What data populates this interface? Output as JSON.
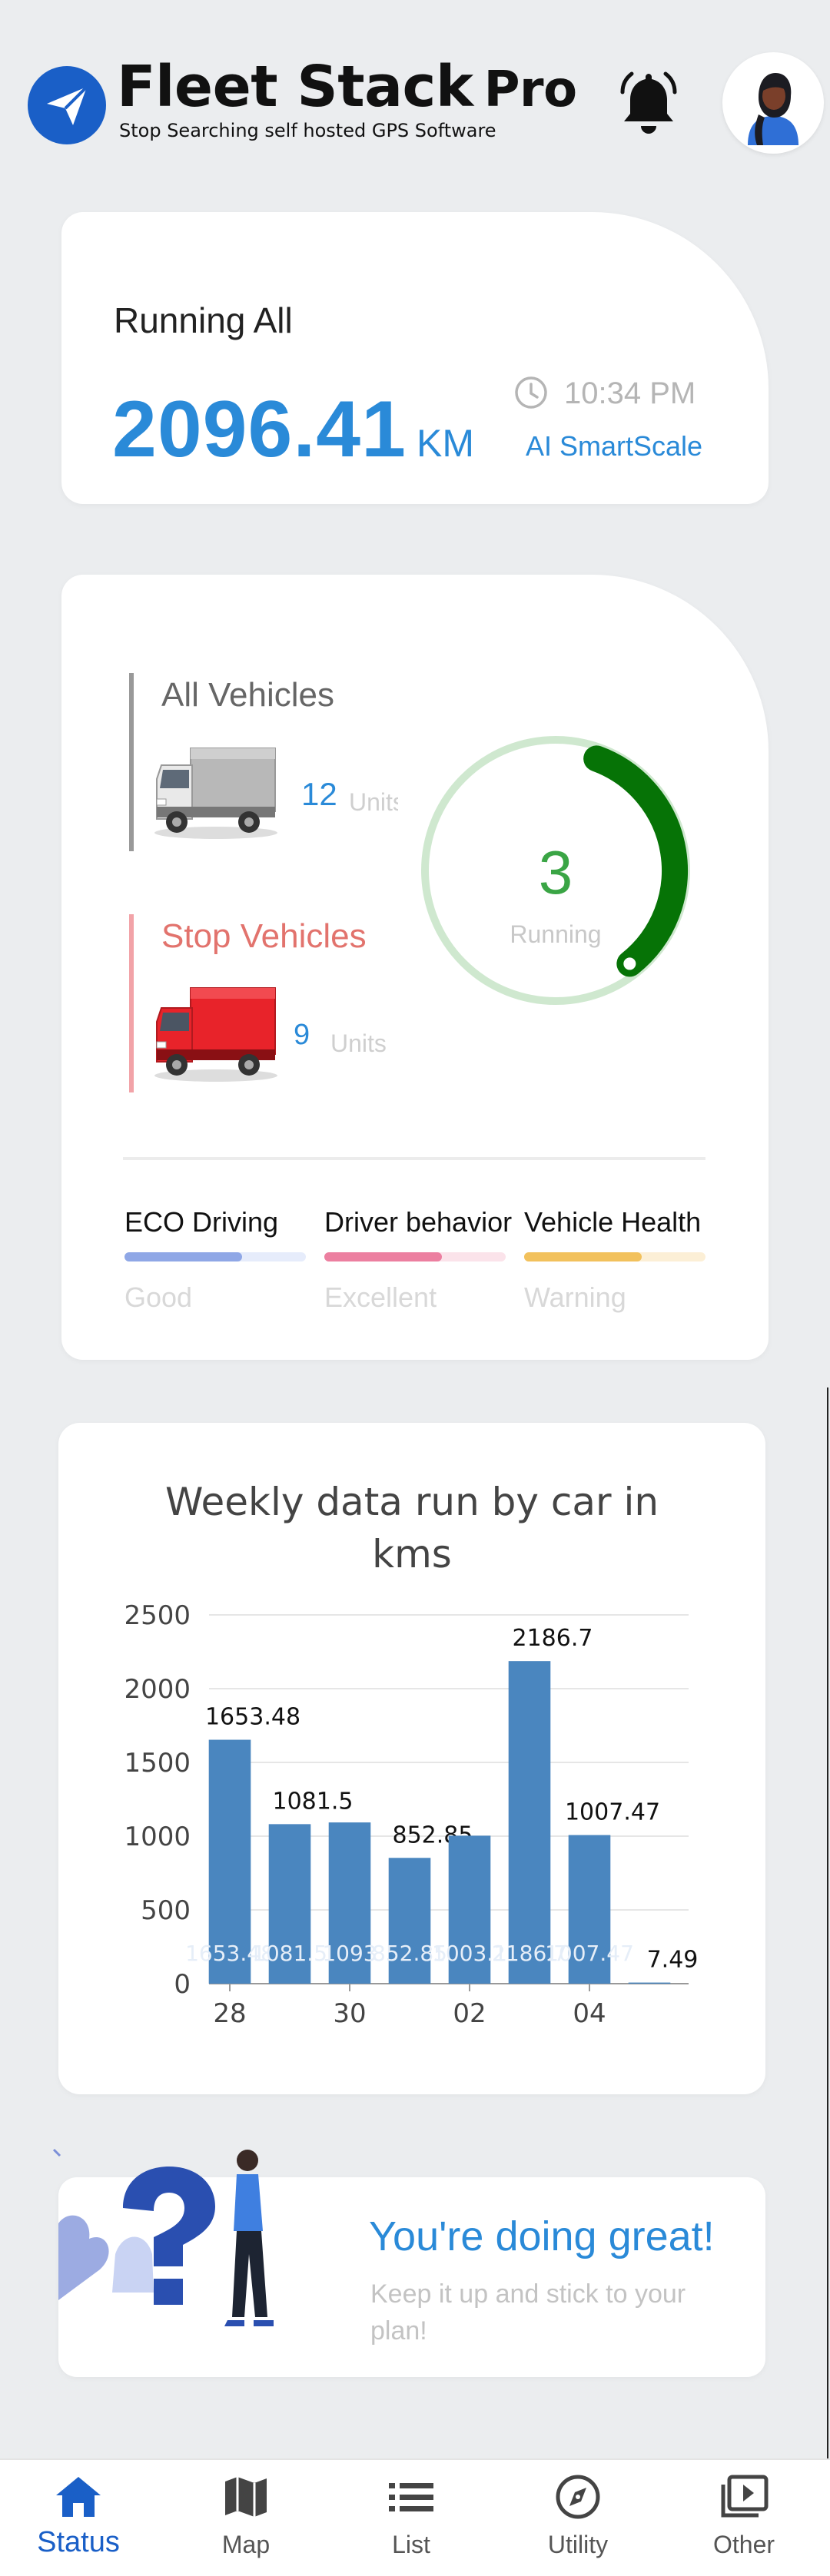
{
  "header": {
    "brand_title": "Fleet Stack",
    "brand_pro": "Pro",
    "brand_subtitle": "Stop Searching self hosted GPS Software",
    "bell_icon": "bell-icon",
    "avatar_icon": "user-avatar"
  },
  "distance_card": {
    "title": "Running All",
    "value": "2096.41",
    "unit": "KM",
    "time": "10:34 PM",
    "smartscale_label": "AI SmartScale"
  },
  "vehicles_card": {
    "all": {
      "title": "All Vehicles",
      "count": "12",
      "unit": "Units"
    },
    "stop": {
      "title": "Stop Vehicles",
      "count": "9",
      "unit": "Units"
    },
    "running": {
      "count": "3",
      "label": "Running",
      "fraction": 0.25
    },
    "metrics": [
      {
        "title": "ECO Driving",
        "value": "Good",
        "fill": 0.65,
        "color": "#8fa7e6",
        "track": "#e6ecfb"
      },
      {
        "title": "Driver behavior",
        "value": "Excellent",
        "fill": 0.65,
        "color": "#ec7fa0",
        "track": "#fbe3ea"
      },
      {
        "title": "Vehicle Health",
        "value": "Warning",
        "fill": 0.65,
        "color": "#f2c15c",
        "track": "#fcefd6"
      }
    ]
  },
  "chart_data": {
    "type": "bar",
    "title": "Weekly data run by car in kms",
    "ylim": [
      0,
      2500
    ],
    "yticks": [
      "0",
      "500",
      "1000",
      "1500",
      "2000",
      "2500"
    ],
    "xticks": [
      "28",
      "30",
      "02",
      "04"
    ],
    "values": [
      1653.48,
      1081.5,
      1093,
      852.85,
      1003.1,
      2186.7,
      1007.47,
      7.49
    ],
    "top_labels": [
      "1653.48",
      "1081.5",
      "",
      "852.85",
      "",
      "2186.7",
      "1007.47",
      "7.49"
    ],
    "inner_labels": [
      "1653.48",
      "1081.5",
      "1093",
      "852.85",
      "1003.1",
      "2186.7",
      "1007.47",
      ""
    ],
    "color": "#4a86bf"
  },
  "banner": {
    "title": "You're doing great!",
    "subtitle": "Keep it up and stick to your plan!"
  },
  "bottom_nav": [
    {
      "label": "Status",
      "icon": "home-icon",
      "active": true
    },
    {
      "label": "Map",
      "icon": "map-icon",
      "active": false
    },
    {
      "label": "List",
      "icon": "list-icon",
      "active": false
    },
    {
      "label": "Utility",
      "icon": "compass-icon",
      "active": false
    },
    {
      "label": "Other",
      "icon": "play-library-icon",
      "active": false
    }
  ]
}
